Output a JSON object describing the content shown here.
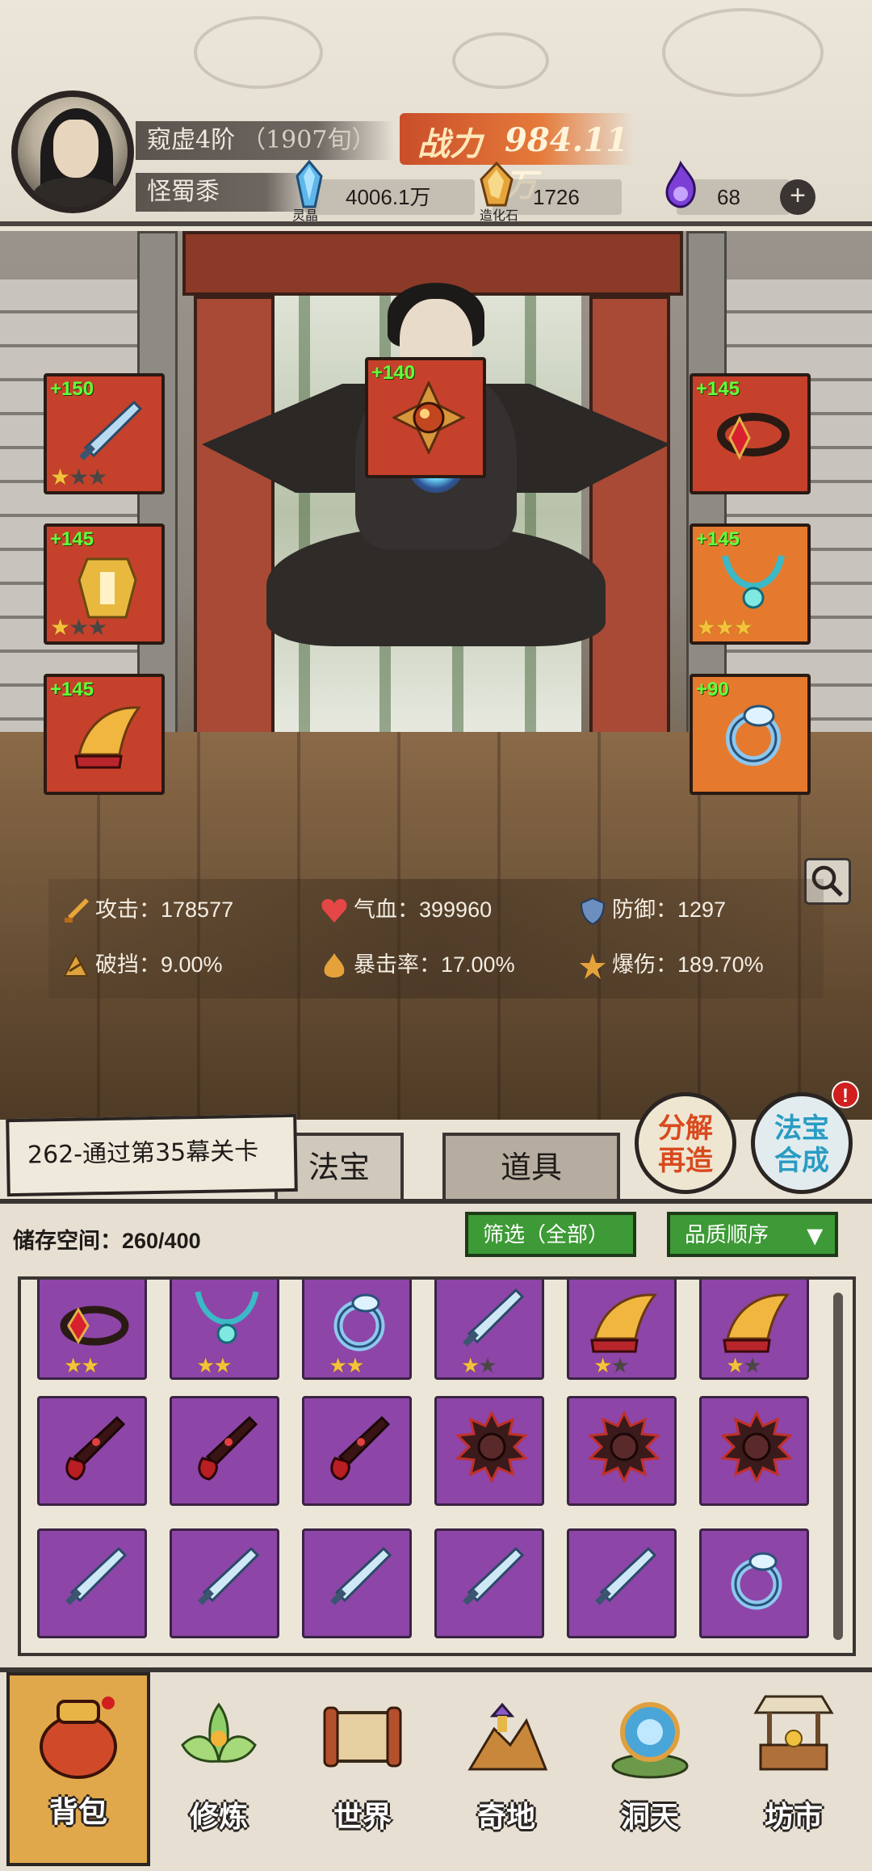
{
  "header": {
    "rank": "窥虚4阶",
    "rank_extra": "（1907旬）",
    "name": "怪蜀黍",
    "power_label": "战力",
    "power_value": "984.11万",
    "resources": [
      {
        "icon": "spirit-crystal-icon",
        "value": "4006.1万",
        "caption": "灵晶"
      },
      {
        "icon": "creation-stone-icon",
        "value": "1726",
        "caption": "造化石"
      },
      {
        "icon": "purple-flame-icon",
        "value": "68"
      }
    ]
  },
  "equipment": {
    "left": [
      {
        "plus": "+150",
        "icon": "sword-icon",
        "stars": 1
      },
      {
        "plus": "+145",
        "icon": "armor-icon",
        "stars": 1
      },
      {
        "plus": "+145",
        "icon": "boots-icon",
        "stars": 0
      }
    ],
    "top": {
      "plus": "+140",
      "icon": "talisman-icon"
    },
    "right": [
      {
        "plus": "+145",
        "icon": "belt-icon"
      },
      {
        "plus": "+145",
        "icon": "necklace-icon",
        "stars": 3
      },
      {
        "plus": "+90",
        "icon": "ring-icon"
      }
    ]
  },
  "stats": [
    {
      "icon": "attack-icon",
      "label": "攻击：",
      "value": "178577"
    },
    {
      "icon": "heart-icon",
      "label": "气血：",
      "value": "399960"
    },
    {
      "icon": "shield-icon",
      "label": "防御：",
      "value": "1297"
    },
    {
      "icon": "break-guard-icon",
      "label": "破挡：",
      "value": "9.00%"
    },
    {
      "icon": "crit-rate-icon",
      "label": "暴击率：",
      "value": "17.00%"
    },
    {
      "icon": "crit-damage-icon",
      "label": "爆伤：",
      "value": "189.70%"
    }
  ],
  "stage_banner": "262-通过第35幕关卡",
  "tabs": [
    "法宝",
    "道具"
  ],
  "actions": {
    "decompose": [
      "分解",
      "再造"
    ],
    "synthesize": [
      "法宝",
      "合成"
    ],
    "badge": "!"
  },
  "storage": "储存空间：260/400",
  "filter_label": "筛选（全部）",
  "sort_label": "品质顺序",
  "inventory": [
    [
      {
        "icon": "belt-icon",
        "stars": 2
      },
      {
        "icon": "necklace-icon",
        "stars": 2
      },
      {
        "icon": "ring-icon",
        "stars": 2
      },
      {
        "icon": "sword-icon",
        "stars": 1
      },
      {
        "icon": "boots-icon",
        "stars": 1
      },
      {
        "icon": "boots-icon",
        "stars": 1
      }
    ],
    [
      {
        "icon": "dark-blade-icon"
      },
      {
        "icon": "dark-blade-icon"
      },
      {
        "icon": "dark-blade-icon"
      },
      {
        "icon": "spiked-wheel-icon"
      },
      {
        "icon": "spiked-wheel-icon"
      },
      {
        "icon": "spiked-wheel-icon"
      }
    ],
    [
      {
        "icon": "sword-icon"
      },
      {
        "icon": "sword-icon"
      },
      {
        "icon": "sword-icon"
      },
      {
        "icon": "sword-icon"
      },
      {
        "icon": "sword-icon"
      },
      {
        "icon": "ring-icon"
      }
    ]
  ],
  "nav": [
    "背包",
    "修炼",
    "世界",
    "奇地",
    "洞天",
    "坊市"
  ]
}
